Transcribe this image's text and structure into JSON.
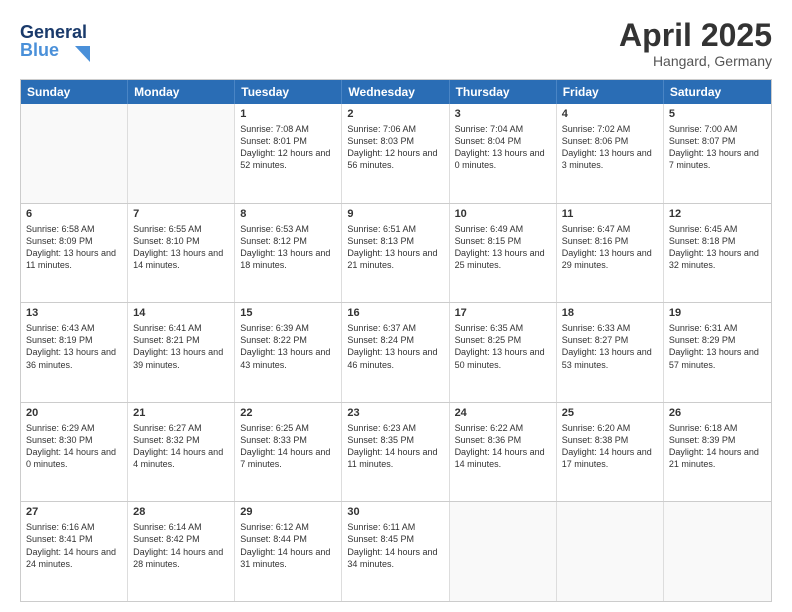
{
  "header": {
    "logo_line1": "General",
    "logo_line2": "Blue",
    "title": "April 2025",
    "subtitle": "Hangard, Germany"
  },
  "days_of_week": [
    "Sunday",
    "Monday",
    "Tuesday",
    "Wednesday",
    "Thursday",
    "Friday",
    "Saturday"
  ],
  "weeks": [
    [
      {
        "day": "",
        "info": "",
        "empty": true
      },
      {
        "day": "",
        "info": "",
        "empty": true
      },
      {
        "day": "1",
        "info": "Sunrise: 7:08 AM\nSunset: 8:01 PM\nDaylight: 12 hours and 52 minutes."
      },
      {
        "day": "2",
        "info": "Sunrise: 7:06 AM\nSunset: 8:03 PM\nDaylight: 12 hours and 56 minutes."
      },
      {
        "day": "3",
        "info": "Sunrise: 7:04 AM\nSunset: 8:04 PM\nDaylight: 13 hours and 0 minutes."
      },
      {
        "day": "4",
        "info": "Sunrise: 7:02 AM\nSunset: 8:06 PM\nDaylight: 13 hours and 3 minutes."
      },
      {
        "day": "5",
        "info": "Sunrise: 7:00 AM\nSunset: 8:07 PM\nDaylight: 13 hours and 7 minutes."
      }
    ],
    [
      {
        "day": "6",
        "info": "Sunrise: 6:58 AM\nSunset: 8:09 PM\nDaylight: 13 hours and 11 minutes."
      },
      {
        "day": "7",
        "info": "Sunrise: 6:55 AM\nSunset: 8:10 PM\nDaylight: 13 hours and 14 minutes."
      },
      {
        "day": "8",
        "info": "Sunrise: 6:53 AM\nSunset: 8:12 PM\nDaylight: 13 hours and 18 minutes."
      },
      {
        "day": "9",
        "info": "Sunrise: 6:51 AM\nSunset: 8:13 PM\nDaylight: 13 hours and 21 minutes."
      },
      {
        "day": "10",
        "info": "Sunrise: 6:49 AM\nSunset: 8:15 PM\nDaylight: 13 hours and 25 minutes."
      },
      {
        "day": "11",
        "info": "Sunrise: 6:47 AM\nSunset: 8:16 PM\nDaylight: 13 hours and 29 minutes."
      },
      {
        "day": "12",
        "info": "Sunrise: 6:45 AM\nSunset: 8:18 PM\nDaylight: 13 hours and 32 minutes."
      }
    ],
    [
      {
        "day": "13",
        "info": "Sunrise: 6:43 AM\nSunset: 8:19 PM\nDaylight: 13 hours and 36 minutes."
      },
      {
        "day": "14",
        "info": "Sunrise: 6:41 AM\nSunset: 8:21 PM\nDaylight: 13 hours and 39 minutes."
      },
      {
        "day": "15",
        "info": "Sunrise: 6:39 AM\nSunset: 8:22 PM\nDaylight: 13 hours and 43 minutes."
      },
      {
        "day": "16",
        "info": "Sunrise: 6:37 AM\nSunset: 8:24 PM\nDaylight: 13 hours and 46 minutes."
      },
      {
        "day": "17",
        "info": "Sunrise: 6:35 AM\nSunset: 8:25 PM\nDaylight: 13 hours and 50 minutes."
      },
      {
        "day": "18",
        "info": "Sunrise: 6:33 AM\nSunset: 8:27 PM\nDaylight: 13 hours and 53 minutes."
      },
      {
        "day": "19",
        "info": "Sunrise: 6:31 AM\nSunset: 8:29 PM\nDaylight: 13 hours and 57 minutes."
      }
    ],
    [
      {
        "day": "20",
        "info": "Sunrise: 6:29 AM\nSunset: 8:30 PM\nDaylight: 14 hours and 0 minutes."
      },
      {
        "day": "21",
        "info": "Sunrise: 6:27 AM\nSunset: 8:32 PM\nDaylight: 14 hours and 4 minutes."
      },
      {
        "day": "22",
        "info": "Sunrise: 6:25 AM\nSunset: 8:33 PM\nDaylight: 14 hours and 7 minutes."
      },
      {
        "day": "23",
        "info": "Sunrise: 6:23 AM\nSunset: 8:35 PM\nDaylight: 14 hours and 11 minutes."
      },
      {
        "day": "24",
        "info": "Sunrise: 6:22 AM\nSunset: 8:36 PM\nDaylight: 14 hours and 14 minutes."
      },
      {
        "day": "25",
        "info": "Sunrise: 6:20 AM\nSunset: 8:38 PM\nDaylight: 14 hours and 17 minutes."
      },
      {
        "day": "26",
        "info": "Sunrise: 6:18 AM\nSunset: 8:39 PM\nDaylight: 14 hours and 21 minutes."
      }
    ],
    [
      {
        "day": "27",
        "info": "Sunrise: 6:16 AM\nSunset: 8:41 PM\nDaylight: 14 hours and 24 minutes."
      },
      {
        "day": "28",
        "info": "Sunrise: 6:14 AM\nSunset: 8:42 PM\nDaylight: 14 hours and 28 minutes."
      },
      {
        "day": "29",
        "info": "Sunrise: 6:12 AM\nSunset: 8:44 PM\nDaylight: 14 hours and 31 minutes."
      },
      {
        "day": "30",
        "info": "Sunrise: 6:11 AM\nSunset: 8:45 PM\nDaylight: 14 hours and 34 minutes."
      },
      {
        "day": "",
        "info": "",
        "empty": true
      },
      {
        "day": "",
        "info": "",
        "empty": true
      },
      {
        "day": "",
        "info": "",
        "empty": true
      }
    ]
  ]
}
